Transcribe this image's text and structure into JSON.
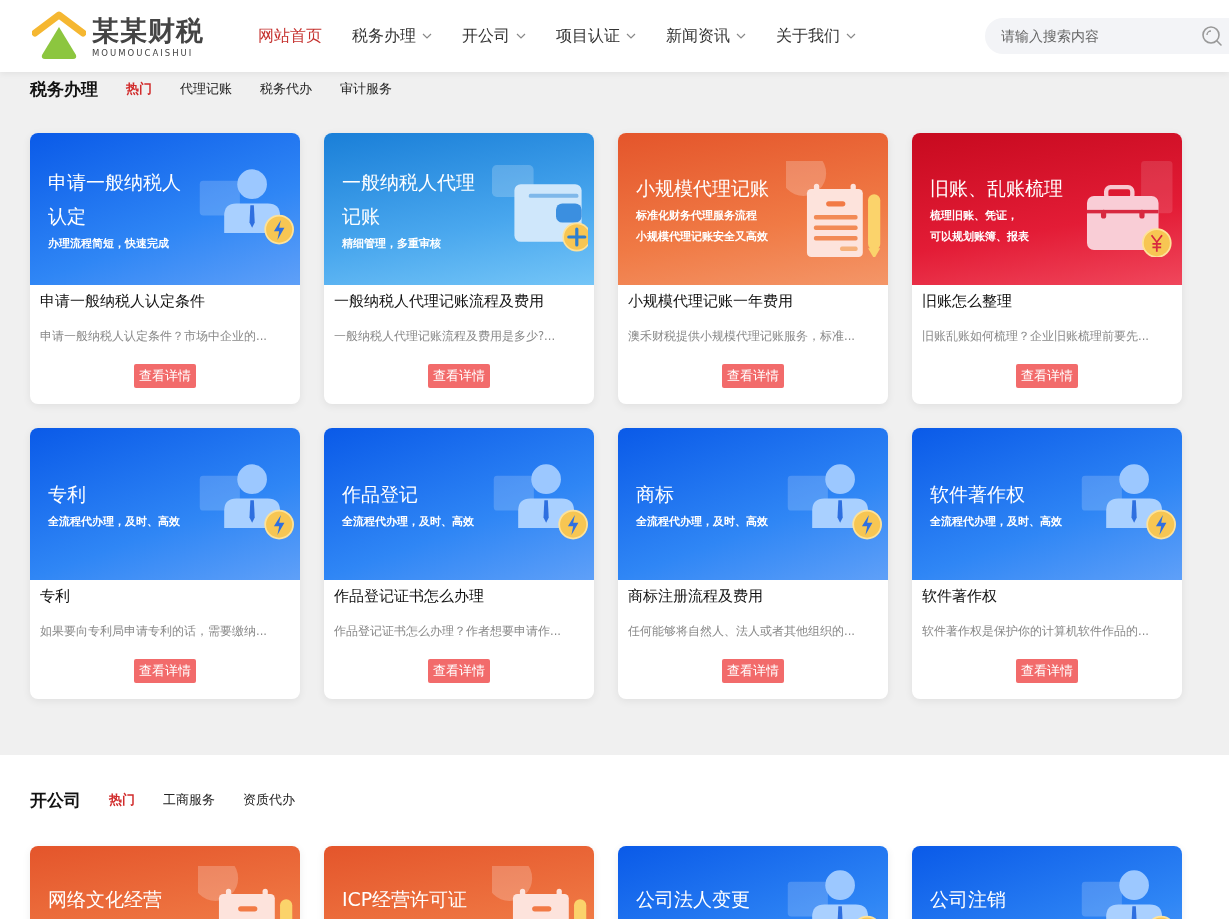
{
  "header": {
    "logo": {
      "name": "某某财税",
      "subtitle": "MOUMOUCAISHUI"
    },
    "nav": [
      {
        "label": "网站首页",
        "selected": true,
        "dropdown": false
      },
      {
        "label": "税务办理",
        "selected": false,
        "dropdown": true
      },
      {
        "label": "开公司",
        "selected": false,
        "dropdown": true
      },
      {
        "label": "项目认证",
        "selected": false,
        "dropdown": true
      },
      {
        "label": "新闻资讯",
        "selected": false,
        "dropdown": true
      },
      {
        "label": "关于我们",
        "selected": false,
        "dropdown": true
      }
    ],
    "search": {
      "placeholder": "请输入搜索内容"
    }
  },
  "sections": [
    {
      "title": "税务办理",
      "tabs": [
        {
          "label": "热门",
          "selected": true
        },
        {
          "label": "代理记账",
          "selected": false
        },
        {
          "label": "税务代办",
          "selected": false
        },
        {
          "label": "审计服务",
          "selected": false
        }
      ],
      "cards": [
        {
          "banner": {
            "kind": "person-bolt",
            "title": "申请一般纳税人认定",
            "lines": [
              "办理流程简短，快速完成"
            ]
          },
          "title": "申请一般纳税人认定条件",
          "desc": "申请一般纳税人认定条件？市场中企业的...",
          "button": "查看详情"
        },
        {
          "banner": {
            "kind": "wallet-plus",
            "title": "一般纳税人代理记账",
            "lines": [
              "精细管理，多重审核"
            ]
          },
          "title": "一般纳税人代理记账流程及费用",
          "desc": "一般纳税人代理记账流程及费用是多少?...",
          "button": "查看详情"
        },
        {
          "banner": {
            "kind": "notepad-pen",
            "title": "小规模代理记账",
            "lines": [
              "标准化财务代理服务流程",
              "小规模代理记账安全又高效"
            ]
          },
          "title": "小规模代理记账一年费用",
          "desc": "澳禾财税提供小规模代理记账服务，标准...",
          "button": "查看详情"
        },
        {
          "banner": {
            "kind": "briefcase-yen",
            "title": "旧账、乱账梳理",
            "lines": [
              "梳理旧账、凭证，",
              "可以规划账簿、报表"
            ]
          },
          "title": "旧账怎么整理",
          "desc": "旧账乱账如何梳理？企业旧账梳理前要先...",
          "button": "查看详情"
        },
        {
          "banner": {
            "kind": "person-bolt",
            "title": "专利",
            "lines": [
              "全流程代办理，及时、高效"
            ]
          },
          "title": "专利",
          "desc": "如果要向专利局申请专利的话，需要缴纳...",
          "button": "查看详情"
        },
        {
          "banner": {
            "kind": "person-bolt",
            "title": "作品登记",
            "lines": [
              "全流程代办理，及时、高效"
            ]
          },
          "title": "作品登记证书怎么办理",
          "desc": "作品登记证书怎么办理？作者想要申请作...",
          "button": "查看详情"
        },
        {
          "banner": {
            "kind": "person-bolt",
            "title": "商标",
            "lines": [
              "全流程代办理，及时、高效"
            ]
          },
          "title": "商标注册流程及费用",
          "desc": "任何能够将自然人、法人或者其他组织的...",
          "button": "查看详情"
        },
        {
          "banner": {
            "kind": "person-bolt",
            "title": "软件著作权",
            "lines": [
              "全流程代办理，及时、高效"
            ]
          },
          "title": "软件著作权",
          "desc": "软件著作权是保护你的计算机软件作品的...",
          "button": "查看详情"
        }
      ]
    },
    {
      "title": "开公司",
      "tabs": [
        {
          "label": "热门",
          "selected": true
        },
        {
          "label": "工商服务",
          "selected": false
        },
        {
          "label": "资质代办",
          "selected": false
        }
      ],
      "cards": [
        {
          "banner": {
            "kind": "notepad-pen",
            "title": "网络文化经营"
          }
        },
        {
          "banner": {
            "kind": "notepad-pen",
            "title": "ICP经营许可证"
          }
        },
        {
          "banner": {
            "kind": "person-bolt",
            "title": "公司法人变更"
          }
        },
        {
          "banner": {
            "kind": "person-bolt",
            "title": "公司注销"
          }
        }
      ]
    }
  ]
}
